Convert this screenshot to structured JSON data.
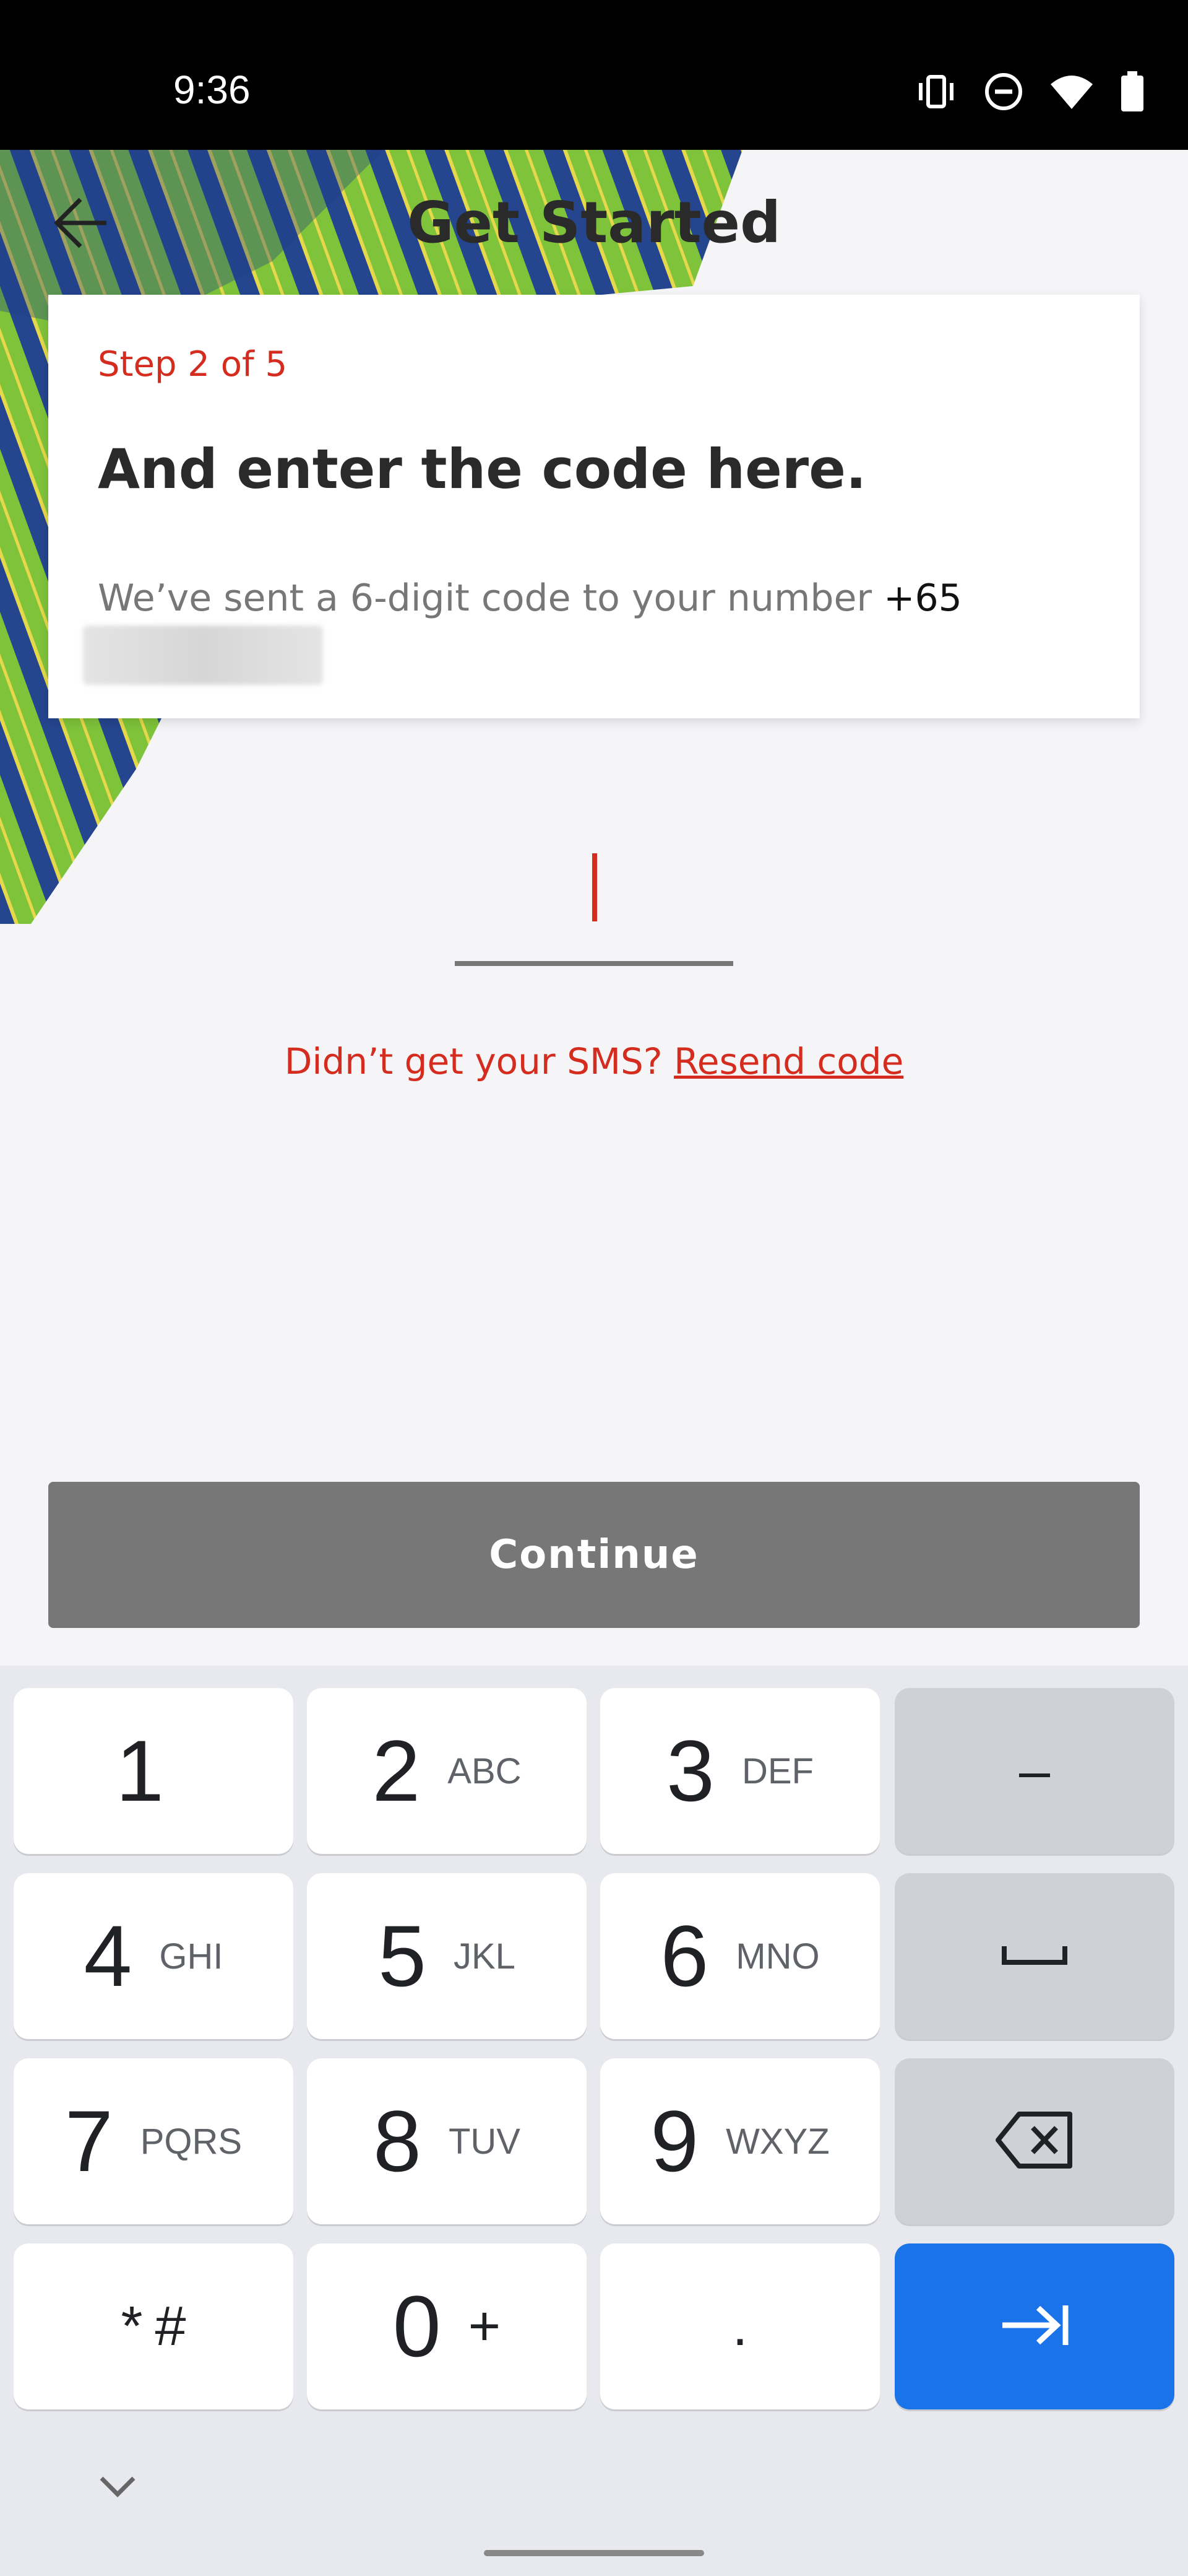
{
  "status_bar": {
    "time": "9:36",
    "icons": [
      "vibrate-icon",
      "do-not-disturb-icon",
      "wifi-icon",
      "battery-icon"
    ]
  },
  "header": {
    "title": "Get Started",
    "back_icon": "arrow-left-icon"
  },
  "card": {
    "step": "Step 2 of 5",
    "title": "And enter the code here.",
    "description": "We’ve sent a 6-digit code to your number",
    "phone_prefix": "+65"
  },
  "code_input": {
    "value": ""
  },
  "resend": {
    "prompt": "Didn’t get your SMS?",
    "link": "Resend code"
  },
  "continue_label": "Continue",
  "keyboard": {
    "keys": [
      {
        "num": "1",
        "letters": ""
      },
      {
        "num": "2",
        "letters": "ABC"
      },
      {
        "num": "3",
        "letters": "DEF"
      },
      {
        "num": "4",
        "letters": "GHI"
      },
      {
        "num": "5",
        "letters": "JKL"
      },
      {
        "num": "6",
        "letters": "MNO"
      },
      {
        "num": "7",
        "letters": "PQRS"
      },
      {
        "num": "8",
        "letters": "TUV"
      },
      {
        "num": "9",
        "letters": "WXYZ"
      },
      {
        "num": "*",
        "letters": "#"
      },
      {
        "num": "0",
        "letters": "+"
      },
      {
        "num": ".",
        "letters": ""
      }
    ],
    "side_keys": [
      "–",
      "space",
      "backspace",
      "next"
    ]
  },
  "colors": {
    "accent": "#d42d1f",
    "continue_disabled": "#777777",
    "keyboard_action": "#1a73e8"
  }
}
